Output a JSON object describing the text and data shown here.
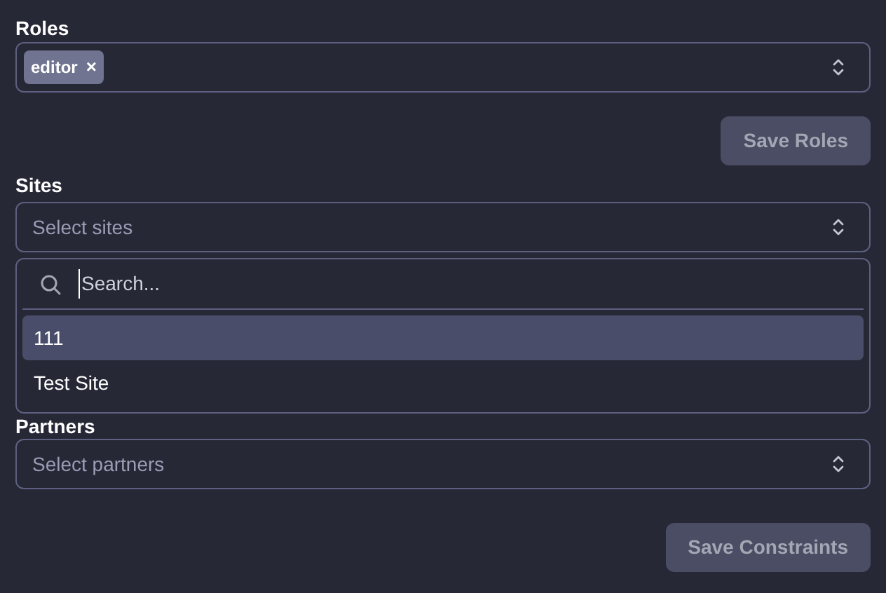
{
  "roles": {
    "label": "Roles",
    "tags": [
      {
        "text": "editor",
        "remove": "×"
      }
    ]
  },
  "save_roles": {
    "label": "Save Roles",
    "disabled": true
  },
  "sites": {
    "label": "Sites",
    "placeholder": "Select sites"
  },
  "sites_dropdown": {
    "search_placeholder": "Search...",
    "options": [
      {
        "label": "111",
        "selected": true
      },
      {
        "label": "Test Site",
        "selected": false
      }
    ]
  },
  "partners": {
    "label": "Partners",
    "placeholder": "Select partners"
  },
  "save_constraints": {
    "label": "Save Constraints",
    "disabled": true
  }
}
